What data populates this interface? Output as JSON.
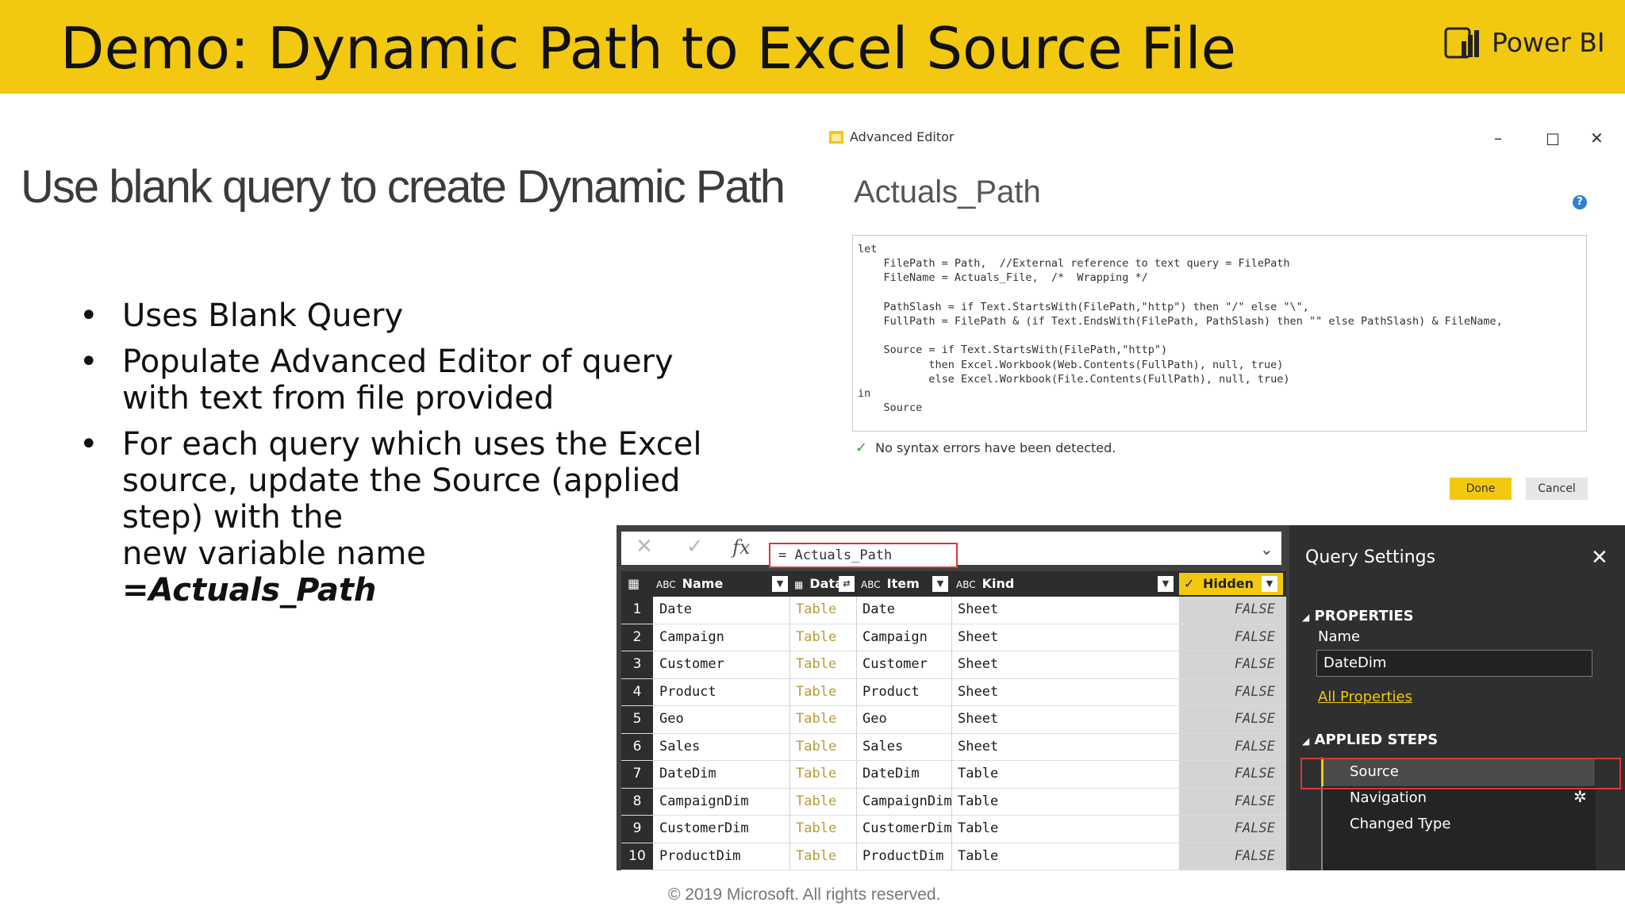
{
  "slide": {
    "title": "Demo:  Dynamic Path to Excel Source File",
    "logo_text": "Power BI",
    "subtitle": "Use blank query to create Dynamic Path",
    "bullets": [
      "Uses Blank Query",
      "Populate Advanced Editor of query with text from file provided",
      "For each query which uses the Excel source, update the Source (applied step) with the"
    ],
    "bullet3_line2": "new variable name",
    "bullet3_emphasis": "=Actuals_Path",
    "footer": "© 2019 Microsoft. All rights reserved."
  },
  "advanced_editor": {
    "window_title": "Advanced Editor",
    "heading": "Actuals_Path",
    "code": "let\n    FilePath = Path,  //External reference to text query = FilePath\n    FileName = Actuals_File,  /*  Wrapping */\n\n    PathSlash = if Text.StartsWith(FilePath,\"http\") then \"/\" else \"\\\",\n    FullPath = FilePath & (if Text.EndsWith(FilePath, PathSlash) then \"\" else PathSlash) & FileName,\n\n    Source = if Text.StartsWith(FilePath,\"http\")\n           then Excel.Workbook(Web.Contents(FullPath), null, true)\n           else Excel.Workbook(File.Contents(FullPath), null, true)\nin\n    Source",
    "status": "No syntax errors have been detected.",
    "done_label": "Done",
    "cancel_label": "Cancel"
  },
  "query_editor": {
    "formula": "= Actuals_Path",
    "columns": [
      {
        "type": "ABC",
        "name": "Name"
      },
      {
        "type": "table",
        "name": "Data"
      },
      {
        "type": "ABC",
        "name": "Item"
      },
      {
        "type": "ABC",
        "name": "Kind"
      },
      {
        "type": "check",
        "name": "Hidden"
      }
    ],
    "rows": [
      {
        "n": "1",
        "name": "Date",
        "data": "Table",
        "item": "Date",
        "kind": "Sheet",
        "hidden": "FALSE"
      },
      {
        "n": "2",
        "name": "Campaign",
        "data": "Table",
        "item": "Campaign",
        "kind": "Sheet",
        "hidden": "FALSE"
      },
      {
        "n": "3",
        "name": "Customer",
        "data": "Table",
        "item": "Customer",
        "kind": "Sheet",
        "hidden": "FALSE"
      },
      {
        "n": "4",
        "name": "Product",
        "data": "Table",
        "item": "Product",
        "kind": "Sheet",
        "hidden": "FALSE"
      },
      {
        "n": "5",
        "name": "Geo",
        "data": "Table",
        "item": "Geo",
        "kind": "Sheet",
        "hidden": "FALSE"
      },
      {
        "n": "6",
        "name": "Sales",
        "data": "Table",
        "item": "Sales",
        "kind": "Sheet",
        "hidden": "FALSE"
      },
      {
        "n": "7",
        "name": "DateDim",
        "data": "Table",
        "item": "DateDim",
        "kind": "Table",
        "hidden": "FALSE"
      },
      {
        "n": "8",
        "name": "CampaignDim",
        "data": "Table",
        "item": "CampaignDim",
        "kind": "Table",
        "hidden": "FALSE"
      },
      {
        "n": "9",
        "name": "CustomerDim",
        "data": "Table",
        "item": "CustomerDim",
        "kind": "Table",
        "hidden": "FALSE"
      },
      {
        "n": "10",
        "name": "ProductDim",
        "data": "Table",
        "item": "ProductDim",
        "kind": "Table",
        "hidden": "FALSE"
      }
    ]
  },
  "query_settings": {
    "title": "Query Settings",
    "properties_header": "PROPERTIES",
    "name_label": "Name",
    "name_value": "DateDim",
    "all_properties": "All Properties",
    "applied_steps_header": "APPLIED STEPS",
    "steps": [
      "Source",
      "Navigation",
      "Changed Type"
    ]
  },
  "colors": {
    "accent": "#f2c811",
    "highlight_border": "#e03535",
    "dark_panel": "#2f2f2f"
  }
}
